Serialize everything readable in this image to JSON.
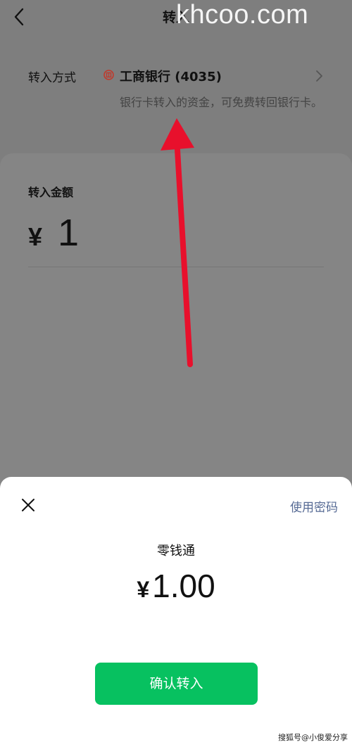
{
  "nav": {
    "title": "转入"
  },
  "watermark": "khcoo.com",
  "method": {
    "label": "转入方式",
    "bank": "工商银行 (4035)",
    "description": "银行卡转入的资金，可免费转回银行卡。"
  },
  "amount": {
    "label": "转入金额",
    "currency": "¥",
    "value": "1"
  },
  "sheet": {
    "use_password": "使用密码",
    "source": "零钱通",
    "currency": "¥",
    "amount": "1.00",
    "confirm": "确认转入"
  },
  "credit": "搜狐号@小俊爱分享",
  "colors": {
    "accent": "#07c160",
    "link": "#576b95",
    "bank_icon": "#c0392b",
    "annotation": "#e8102c"
  }
}
